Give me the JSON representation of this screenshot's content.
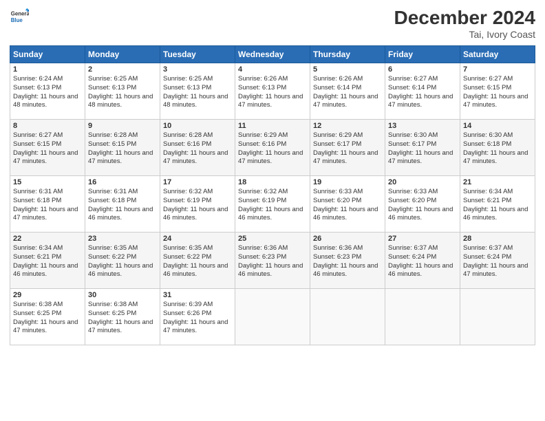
{
  "header": {
    "logo_line1": "General",
    "logo_line2": "Blue",
    "month": "December 2024",
    "location": "Tai, Ivory Coast"
  },
  "weekdays": [
    "Sunday",
    "Monday",
    "Tuesday",
    "Wednesday",
    "Thursday",
    "Friday",
    "Saturday"
  ],
  "weeks": [
    [
      {
        "day": "1",
        "sunrise": "6:24 AM",
        "sunset": "6:13 PM",
        "daylight": "11 hours and 48 minutes."
      },
      {
        "day": "2",
        "sunrise": "6:25 AM",
        "sunset": "6:13 PM",
        "daylight": "11 hours and 48 minutes."
      },
      {
        "day": "3",
        "sunrise": "6:25 AM",
        "sunset": "6:13 PM",
        "daylight": "11 hours and 48 minutes."
      },
      {
        "day": "4",
        "sunrise": "6:26 AM",
        "sunset": "6:13 PM",
        "daylight": "11 hours and 47 minutes."
      },
      {
        "day": "5",
        "sunrise": "6:26 AM",
        "sunset": "6:14 PM",
        "daylight": "11 hours and 47 minutes."
      },
      {
        "day": "6",
        "sunrise": "6:27 AM",
        "sunset": "6:14 PM",
        "daylight": "11 hours and 47 minutes."
      },
      {
        "day": "7",
        "sunrise": "6:27 AM",
        "sunset": "6:15 PM",
        "daylight": "11 hours and 47 minutes."
      }
    ],
    [
      {
        "day": "8",
        "sunrise": "6:27 AM",
        "sunset": "6:15 PM",
        "daylight": "11 hours and 47 minutes."
      },
      {
        "day": "9",
        "sunrise": "6:28 AM",
        "sunset": "6:15 PM",
        "daylight": "11 hours and 47 minutes."
      },
      {
        "day": "10",
        "sunrise": "6:28 AM",
        "sunset": "6:16 PM",
        "daylight": "11 hours and 47 minutes."
      },
      {
        "day": "11",
        "sunrise": "6:29 AM",
        "sunset": "6:16 PM",
        "daylight": "11 hours and 47 minutes."
      },
      {
        "day": "12",
        "sunrise": "6:29 AM",
        "sunset": "6:17 PM",
        "daylight": "11 hours and 47 minutes."
      },
      {
        "day": "13",
        "sunrise": "6:30 AM",
        "sunset": "6:17 PM",
        "daylight": "11 hours and 47 minutes."
      },
      {
        "day": "14",
        "sunrise": "6:30 AM",
        "sunset": "6:18 PM",
        "daylight": "11 hours and 47 minutes."
      }
    ],
    [
      {
        "day": "15",
        "sunrise": "6:31 AM",
        "sunset": "6:18 PM",
        "daylight": "11 hours and 47 minutes."
      },
      {
        "day": "16",
        "sunrise": "6:31 AM",
        "sunset": "6:18 PM",
        "daylight": "11 hours and 46 minutes."
      },
      {
        "day": "17",
        "sunrise": "6:32 AM",
        "sunset": "6:19 PM",
        "daylight": "11 hours and 46 minutes."
      },
      {
        "day": "18",
        "sunrise": "6:32 AM",
        "sunset": "6:19 PM",
        "daylight": "11 hours and 46 minutes."
      },
      {
        "day": "19",
        "sunrise": "6:33 AM",
        "sunset": "6:20 PM",
        "daylight": "11 hours and 46 minutes."
      },
      {
        "day": "20",
        "sunrise": "6:33 AM",
        "sunset": "6:20 PM",
        "daylight": "11 hours and 46 minutes."
      },
      {
        "day": "21",
        "sunrise": "6:34 AM",
        "sunset": "6:21 PM",
        "daylight": "11 hours and 46 minutes."
      }
    ],
    [
      {
        "day": "22",
        "sunrise": "6:34 AM",
        "sunset": "6:21 PM",
        "daylight": "11 hours and 46 minutes."
      },
      {
        "day": "23",
        "sunrise": "6:35 AM",
        "sunset": "6:22 PM",
        "daylight": "11 hours and 46 minutes."
      },
      {
        "day": "24",
        "sunrise": "6:35 AM",
        "sunset": "6:22 PM",
        "daylight": "11 hours and 46 minutes."
      },
      {
        "day": "25",
        "sunrise": "6:36 AM",
        "sunset": "6:23 PM",
        "daylight": "11 hours and 46 minutes."
      },
      {
        "day": "26",
        "sunrise": "6:36 AM",
        "sunset": "6:23 PM",
        "daylight": "11 hours and 46 minutes."
      },
      {
        "day": "27",
        "sunrise": "6:37 AM",
        "sunset": "6:24 PM",
        "daylight": "11 hours and 46 minutes."
      },
      {
        "day": "28",
        "sunrise": "6:37 AM",
        "sunset": "6:24 PM",
        "daylight": "11 hours and 47 minutes."
      }
    ],
    [
      {
        "day": "29",
        "sunrise": "6:38 AM",
        "sunset": "6:25 PM",
        "daylight": "11 hours and 47 minutes."
      },
      {
        "day": "30",
        "sunrise": "6:38 AM",
        "sunset": "6:25 PM",
        "daylight": "11 hours and 47 minutes."
      },
      {
        "day": "31",
        "sunrise": "6:39 AM",
        "sunset": "6:26 PM",
        "daylight": "11 hours and 47 minutes."
      },
      null,
      null,
      null,
      null
    ]
  ]
}
